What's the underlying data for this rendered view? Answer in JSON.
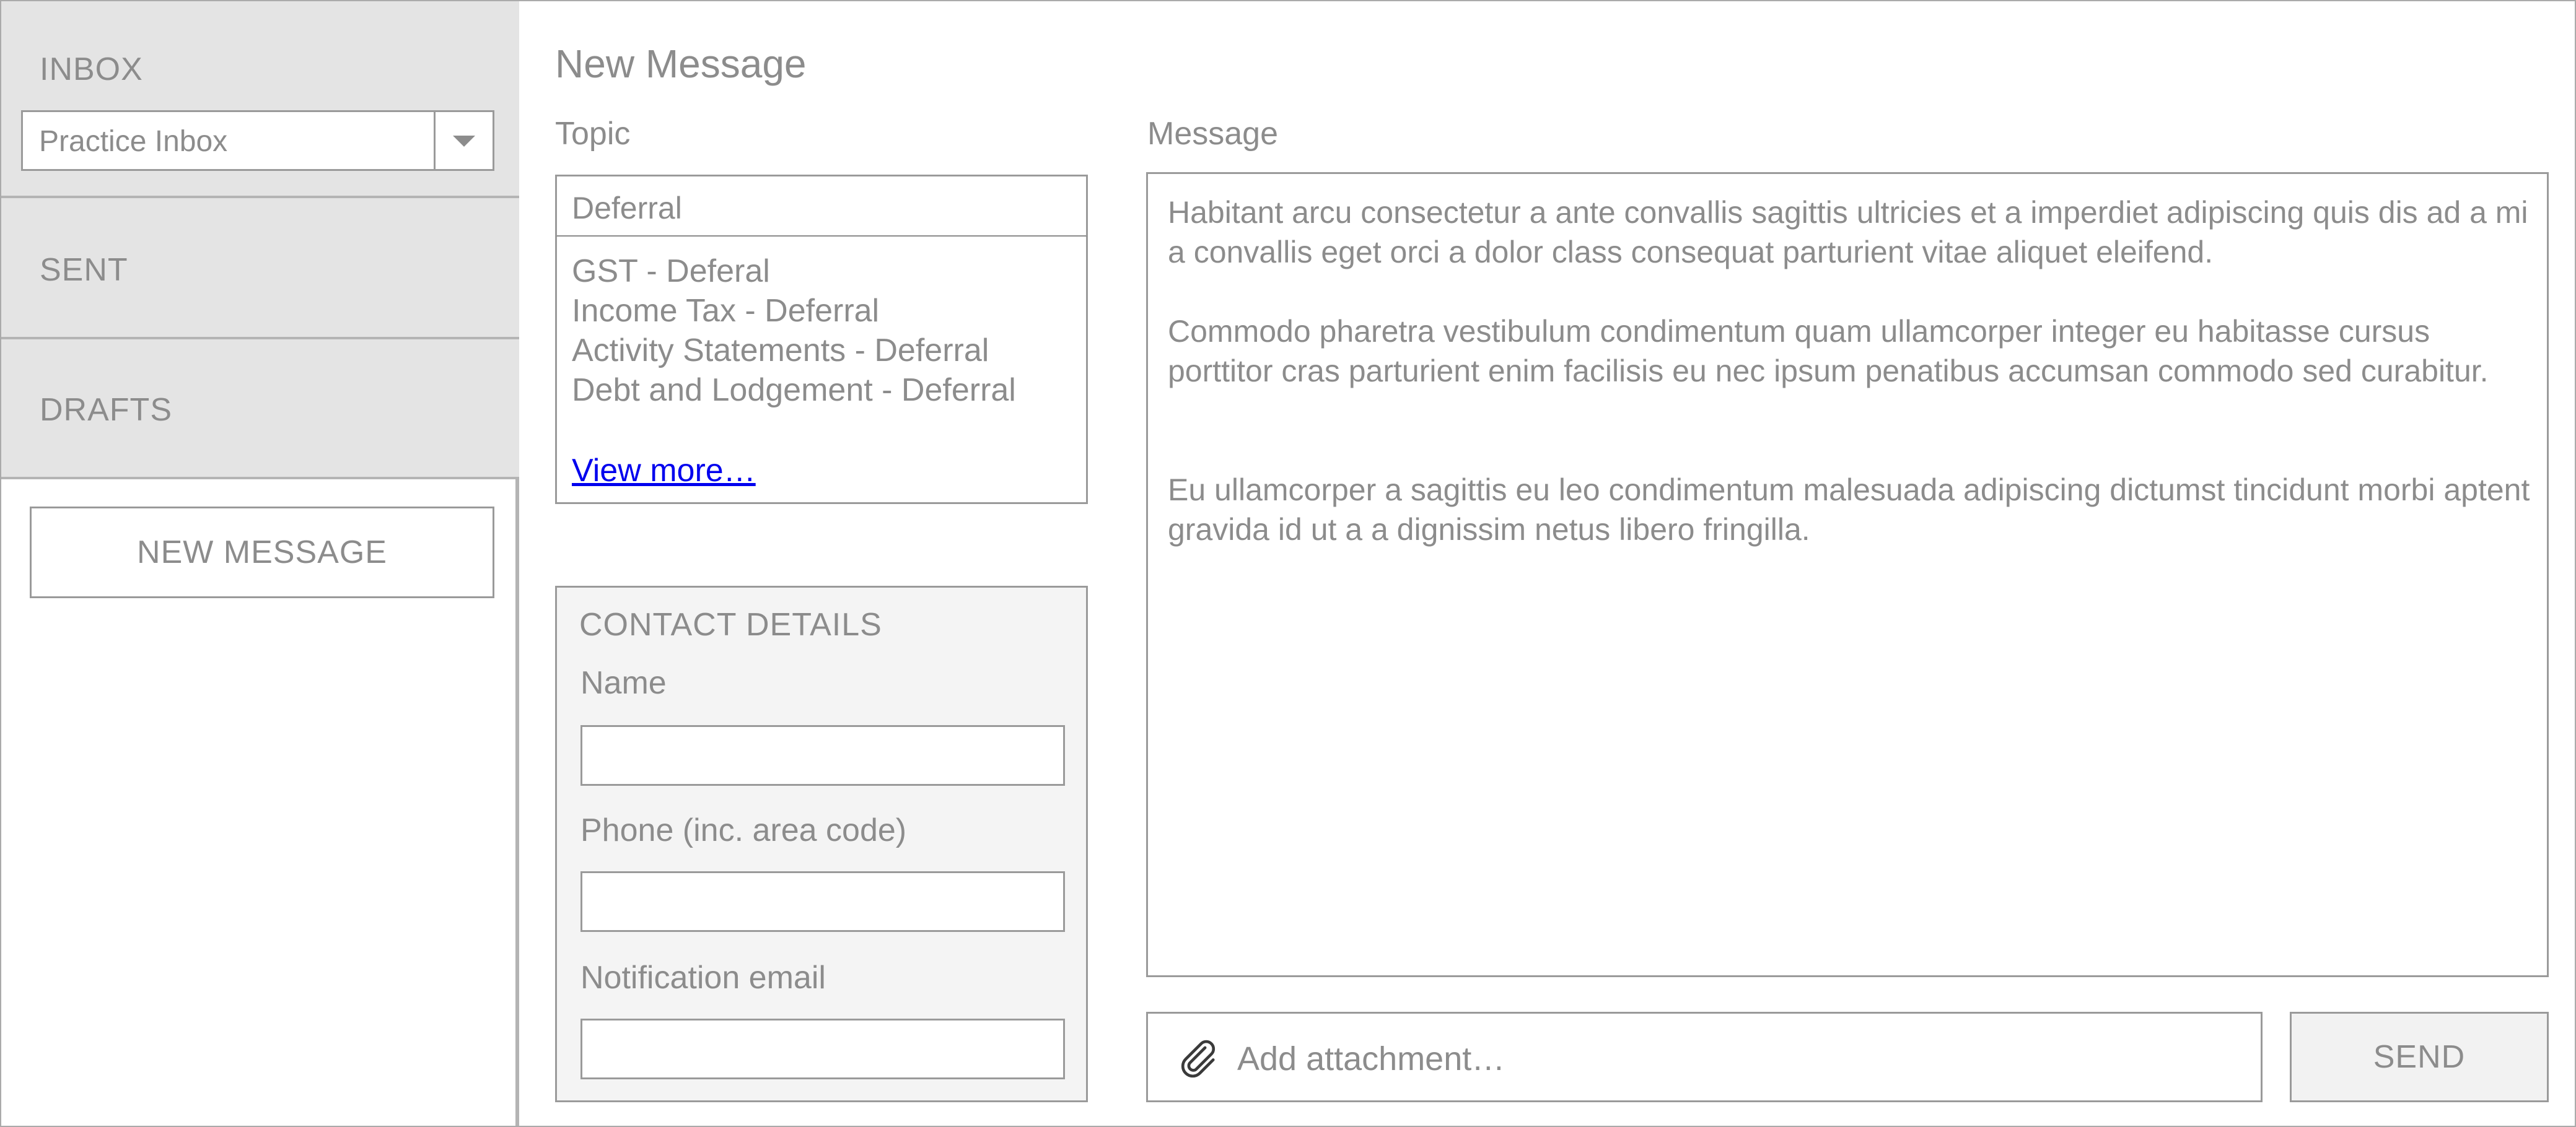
{
  "sidebar": {
    "inbox_label": "INBOX",
    "inbox_select_value": "Practice Inbox",
    "sent_label": "SENT",
    "drafts_label": "DRAFTS",
    "new_message_button": "NEW MESSAGE"
  },
  "compose": {
    "title": "New Message",
    "topic_label": "Topic",
    "topic_value": "Deferral",
    "topic_options": [
      "GST - Deferal",
      "Income Tax - Deferral",
      "Activity Statements - Deferral",
      "Debt and Lodgement - Deferral"
    ],
    "view_more": "View more…",
    "message_label": "Message",
    "message_paragraphs": [
      "Habitant arcu consectetur a ante convallis sagittis ultricies et a imperdiet adipiscing quis dis ad a mi a convallis eget orci a dolor class consequat parturient vitae aliquet eleifend.",
      "Commodo pharetra vestibulum condimentum quam ullamcorper integer eu habitasse cursus porttitor cras parturient enim facilisis eu nec ipsum penatibus accumsan commodo sed curabitur.",
      "Eu ullamcorper a sagittis eu leo condimentum malesuada adipiscing dictumst tincidunt morbi aptent gravida id ut a a dignissim netus libero fringilla."
    ],
    "attachment_placeholder": "Add attachment…",
    "send_button": "SEND"
  },
  "contact": {
    "heading": "CONTACT DETAILS",
    "name_label": "Name",
    "name_value": "",
    "phone_label": "Phone (inc. area code)",
    "phone_value": "",
    "email_label": "Notification email",
    "email_value": ""
  },
  "icons": {
    "dropdown": "chevron-down-icon",
    "attachment": "paperclip-icon"
  },
  "colors": {
    "link": "#0000ee",
    "sidebar_bg": "#e4e4e4",
    "text": "#8c8c8c",
    "border": "#9a9a9a"
  }
}
